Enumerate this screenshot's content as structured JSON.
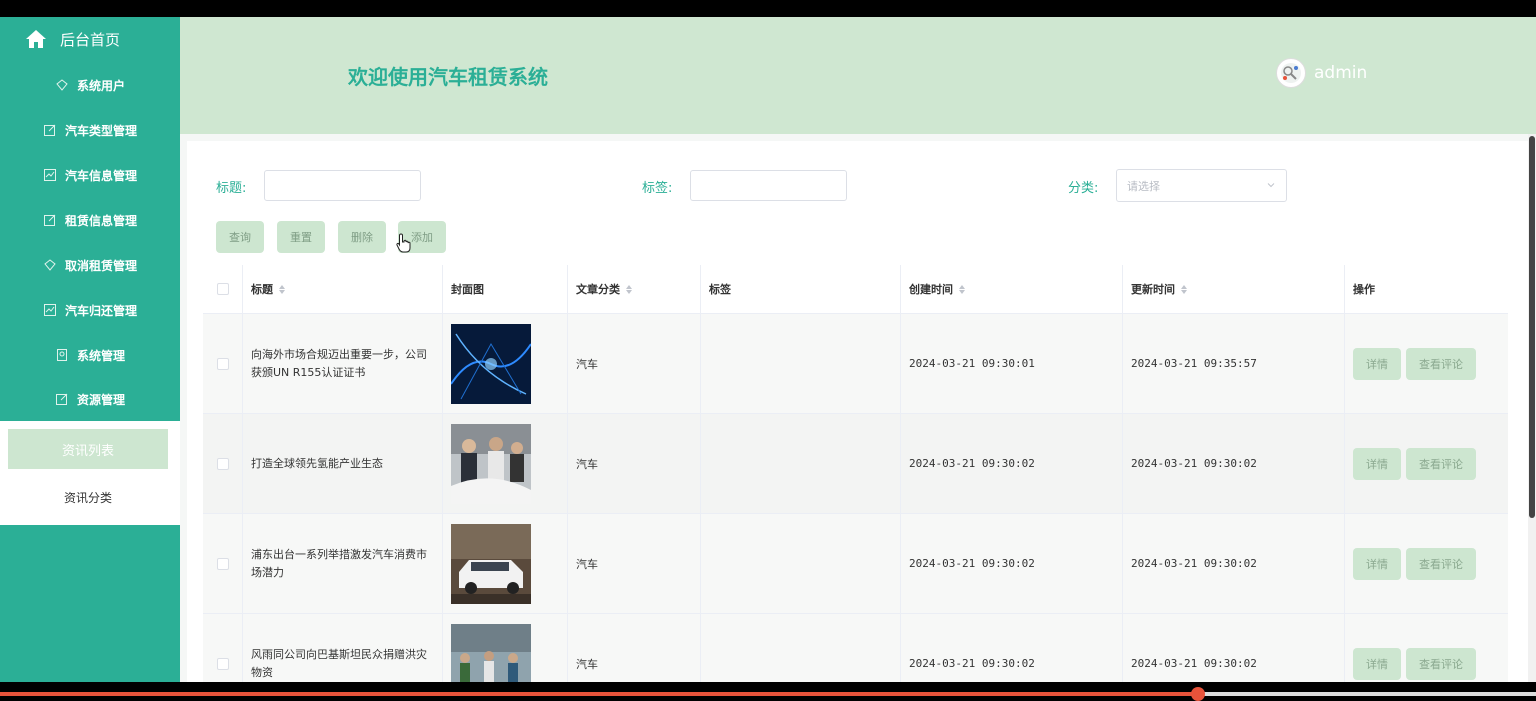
{
  "sidebar": {
    "home_label": "后台首页",
    "items": [
      {
        "label": "系统用户",
        "icon": "diamond-icon"
      },
      {
        "label": "汽车类型管理",
        "icon": "edit-icon"
      },
      {
        "label": "汽车信息管理",
        "icon": "chart-icon"
      },
      {
        "label": "租赁信息管理",
        "icon": "edit-icon"
      },
      {
        "label": "取消租赁管理",
        "icon": "diamond-icon"
      },
      {
        "label": "汽车归还管理",
        "icon": "chart-icon"
      },
      {
        "label": "系统管理",
        "icon": "badge-icon"
      },
      {
        "label": "资源管理",
        "icon": "edit-icon"
      }
    ],
    "submenu": {
      "active": "资讯列表",
      "other": "资讯分类"
    }
  },
  "header": {
    "welcome": "欢迎使用汽车租赁系统",
    "username": "admin"
  },
  "filters": {
    "title_label": "标题:",
    "tag_label": "标签:",
    "category_label": "分类:",
    "category_placeholder": "请选择"
  },
  "buttons": {
    "query": "查询",
    "reset": "重置",
    "delete": "删除",
    "add": "添加"
  },
  "table": {
    "headers": {
      "title": "标题",
      "cover": "封面图",
      "category": "文章分类",
      "tags": "标签",
      "created": "创建时间",
      "updated": "更新时间",
      "actions": "操作"
    },
    "rows": [
      {
        "title": "向海外市场合规迈出重要一步，公司获颁UN R155认证证书",
        "category": "汽车",
        "tags": "",
        "created": "2024-03-21 09:30:01",
        "updated": "2024-03-21 09:35:57"
      },
      {
        "title": "打造全球领先氢能产业生态",
        "category": "汽车",
        "tags": "",
        "created": "2024-03-21 09:30:02",
        "updated": "2024-03-21 09:30:02"
      },
      {
        "title": "浦东出台一系列举措激发汽车消费市场潜力",
        "category": "汽车",
        "tags": "",
        "created": "2024-03-21 09:30:02",
        "updated": "2024-03-21 09:30:02"
      },
      {
        "title": "风雨同公司向巴基斯坦民众捐赠洪灾物资",
        "category": "汽车",
        "tags": "",
        "created": "2024-03-21 09:30:02",
        "updated": "2024-03-21 09:30:02"
      }
    ],
    "detail_label": "详情",
    "comments_label": "查看评论"
  },
  "colors": {
    "primary": "#2baf96",
    "header_bg": "#cfe7d1",
    "button_bg": "#cde6d0"
  },
  "video_progress": 0.78
}
